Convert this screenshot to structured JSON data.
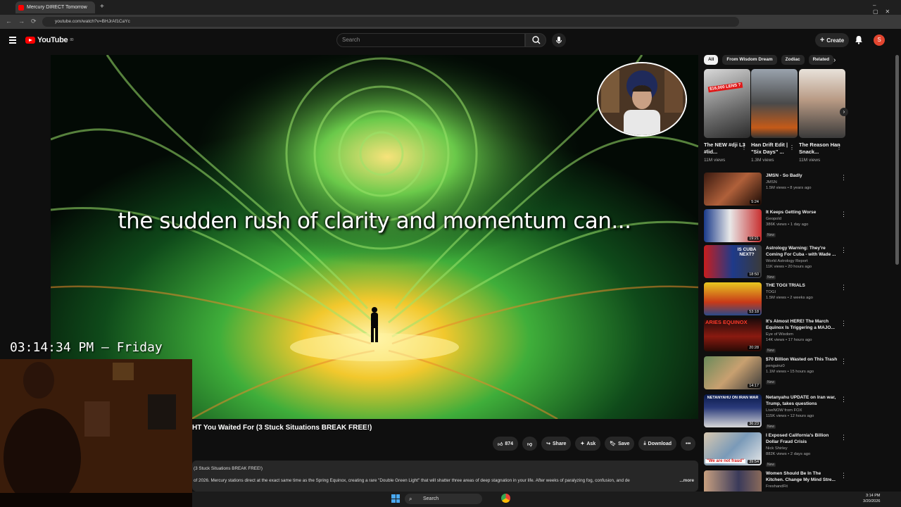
{
  "browser": {
    "tab_title": "Mercury DIRECT Tomorrow",
    "url": "youtube.com/watch?v=BHJrAf1CaYc"
  },
  "header": {
    "logo_text": "YouTube",
    "logo_badge": "80",
    "search_placeholder": "Search",
    "create_label": "Create",
    "avatar_letter": "S"
  },
  "player": {
    "caption": "the sudden rush of clarity and momentum can...",
    "clock_overlay": "03:14:34 PM — Friday"
  },
  "video": {
    "title": "HT You Waited For (3 Stuck Situations BREAK FREE!)",
    "like_count": "874",
    "share_label": "Share",
    "ask_label": "Ask",
    "save_label": "Save",
    "download_label": "Download",
    "description_line1": "(3 Stuck Situations BREAK FREE!)",
    "description_line2": "of 2026. Mercury stations direct at the exact same time as the Spring Equinox, creating a rare \"Double Green Light\" that will shatter three areas of deep stagnation in your life. After weeks of paralyzing fog, confusion, and de",
    "more_label": "...more"
  },
  "chips": [
    "All",
    "From Wisdom Dream",
    "Zodiac",
    "Related"
  ],
  "shorts": [
    {
      "title": "The NEW #dji L3 #lid...",
      "views": "11M views",
      "badge": "$16,000 LENS ?"
    },
    {
      "title": "Han Drift Edit | \"Six Days\" ...",
      "views": "1.3M views"
    },
    {
      "title": "The Reason Han Snack...",
      "views": "11M views"
    }
  ],
  "recommendations": [
    {
      "title": "JMSN - So Badly",
      "channel": "JMSN",
      "stats": "1.5M views • 8 years ago",
      "duration": "5:24",
      "new": ""
    },
    {
      "title": "It Keeps Getting Worse",
      "channel": "Geopold",
      "stats": "386K views • 1 day ago",
      "duration": "19:21",
      "new": "New"
    },
    {
      "title": "Astrology Warning: They're Coming For Cuba - with Wade ...",
      "channel": "World Astrology Report",
      "stats": "11K views • 20 hours ago",
      "duration": "18:50",
      "new": "New",
      "thumb_text": "IS CUBA NEXT?"
    },
    {
      "title": "THE TOGI TRIALS",
      "channel": "TOGI",
      "stats": "1.5M views • 2 weeks ago",
      "duration": "53:18",
      "new": ""
    },
    {
      "title": "It's Almost HERE! The March Equinox Is Triggering a MAJO...",
      "channel": "Eye of Wisdom",
      "stats": "14K views • 17 hours ago",
      "duration": "20:28",
      "new": "New",
      "thumb_text": "ARIES EQUINOX"
    },
    {
      "title": "$70 Billion Wasted on This Trash",
      "channel": "penguinz0",
      "stats": "1.1M views • 15 hours ago",
      "duration": "14:17",
      "new": "New"
    },
    {
      "title": "Netanyahu UPDATE on Iran war, Trump, takes questions",
      "channel": "LiveNOW from FOX",
      "stats": "115K views • 12 hours ago",
      "duration": "36:23",
      "new": "New",
      "thumb_text": "NETANYAHU ON IRAN WAR"
    },
    {
      "title": "I Exposed California's Billion Dollar Fraud Crisis",
      "channel": "Nick Shirley",
      "stats": "882K views • 2 days ago",
      "duration": "39:54",
      "new": "New",
      "thumb_text": "\"We are not fraud\""
    },
    {
      "title": "Women Should Be In The Kitchen. Change My Mind Stre...",
      "channel": "FreshandFit",
      "stats": "",
      "duration": "",
      "new": ""
    }
  ],
  "taskbar": {
    "search_label": "Search",
    "time": "3:14 PM",
    "date": "3/20/2026"
  },
  "colors": {
    "accent": "#ff0000",
    "background": "#0f0f0f",
    "chip_active": "#f1f1f1"
  }
}
